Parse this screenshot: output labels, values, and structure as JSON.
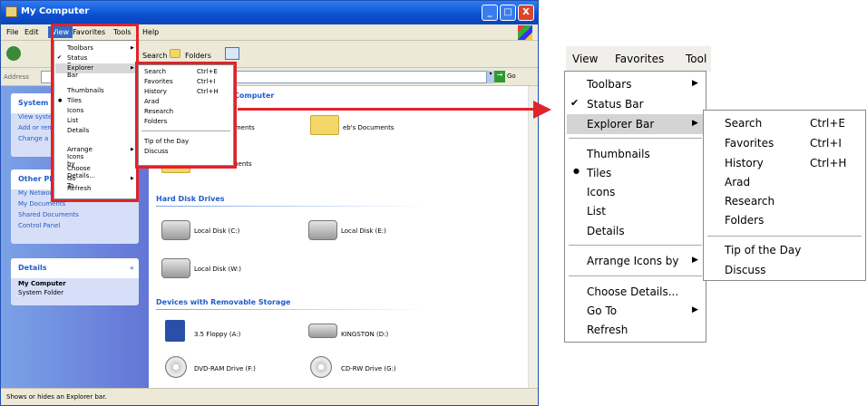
{
  "window": {
    "title": "My Computer",
    "min": "_",
    "max": "□",
    "close": "X"
  },
  "menubar": [
    "File",
    "Edit",
    "View",
    "Favorites",
    "Tools",
    "Help"
  ],
  "toolbar": {
    "search": "Search",
    "folders": "Folders"
  },
  "address": {
    "label": "Address",
    "go": "Go"
  },
  "content": {
    "section_title": "Computer",
    "files_header": "Files Stored on This Computer"
  },
  "sidebar": {
    "system_tasks": {
      "title": "System Tasks",
      "items": [
        "View system information",
        "Add or remove programs",
        "Change a setting"
      ]
    },
    "other_places": {
      "title": "Other Places",
      "items": [
        "My Network Places",
        "My Documents",
        "Shared Documents",
        "Control Panel"
      ]
    },
    "details": {
      "title": "Details",
      "name": "My Computer",
      "desc": "System Folder"
    }
  },
  "groups": {
    "hdd": "Hard Disk Drives",
    "removable": "Devices with Removable Storage"
  },
  "items": {
    "shared_docs": "Shared Documents",
    "eb_docs": "eb's Documents",
    "user_docs": "User's Documents",
    "c": "Local Disk (C:)",
    "e": "Local Disk (E:)",
    "w": "Local Disk (W:)",
    "a": "3.5 Floppy (A:)",
    "d": "KINGSTON (D:)",
    "f": "DVD-RAM Drive (F:)",
    "g": "CD-RW Drive (G:)"
  },
  "status": "Shows or hides an Explorer bar.",
  "view_menu": {
    "toolbars": "Toolbars",
    "status_bar": "Status Bar",
    "explorer_bar": "Explorer Bar",
    "thumbnails": "Thumbnails",
    "tiles": "Tiles",
    "icons": "Icons",
    "list": "List",
    "details": "Details",
    "arrange": "Arrange Icons by",
    "choose": "Choose Details...",
    "goto": "Go To",
    "refresh": "Refresh",
    "check": "✔",
    "bullet": "●",
    "arrow": "▶"
  },
  "explorer_submenu": {
    "search": "Search",
    "search_key": "Ctrl+E",
    "favorites": "Favorites",
    "favorites_key": "Ctrl+I",
    "history": "History",
    "history_key": "Ctrl+H",
    "arad": "Arad",
    "research": "Research",
    "folders": "Folders",
    "tip": "Tip of the Day",
    "discuss": "Discuss"
  },
  "zoom_menubar": {
    "view": "View",
    "favorites": "Favorites",
    "tools": "Tool"
  },
  "colors": {
    "accent": "#e0232a",
    "xp_blue": "#0a4fd0",
    "task_pane": "#6375d6"
  }
}
